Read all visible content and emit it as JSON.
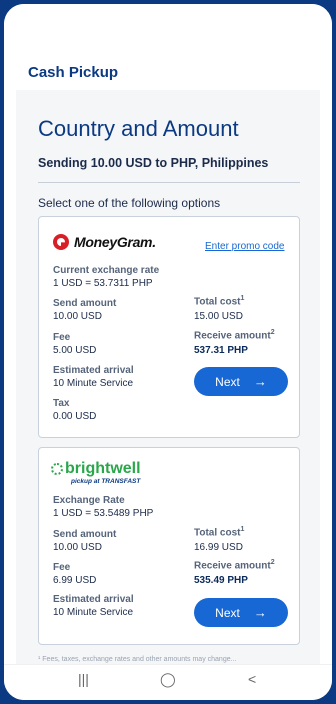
{
  "appbar": {
    "title": "Cash Pickup"
  },
  "page": {
    "heading": "Country and Amount",
    "sending": "Sending 10.00 USD to PHP, Philippines",
    "select_label": "Select one of the following options"
  },
  "moneygram": {
    "logo_text": "MoneyGram.",
    "promo": "Enter promo code",
    "rate_label": "Current exchange rate",
    "rate_value": "1 USD = 53.7311 PHP",
    "send_label": "Send amount",
    "send_value": "10.00 USD",
    "total_label": "Total cost",
    "total_sup": "1",
    "total_value": "15.00 USD",
    "fee_label": "Fee",
    "fee_value": "5.00 USD",
    "receive_label": "Receive amount",
    "receive_sup": "2",
    "receive_value": "537.31 PHP",
    "arrival_label": "Estimated arrival",
    "arrival_value": "10 Minute Service",
    "tax_label": "Tax",
    "tax_value": "0.00 USD",
    "next_label": "Next",
    "arrow": "→"
  },
  "brightwell": {
    "logo_text": "brightwell",
    "logo_sub": "pickup at TRANSFAST",
    "rate_label": "Exchange Rate",
    "rate_value": "1 USD = 53.5489 PHP",
    "send_label": "Send amount",
    "send_value": "10.00 USD",
    "total_label": "Total cost",
    "total_sup": "1",
    "total_value": "16.99 USD",
    "fee_label": "Fee",
    "fee_value": "6.99 USD",
    "receive_label": "Receive amount",
    "receive_sup": "2",
    "receive_value": "535.49 PHP",
    "arrival_label": "Estimated arrival",
    "arrival_value": "10 Minute Service",
    "next_label": "Next",
    "arrow": "→"
  },
  "footnote": "¹ Fees, taxes, exchange rates and other amounts may change...",
  "nav": {
    "recents": "|||",
    "home": "◯",
    "back": "<"
  },
  "colors": {
    "brand_blue": "#0b3a82",
    "button_blue": "#1767d4",
    "moneygram_red": "#d81f26",
    "brightwell_green": "#2aa74a"
  }
}
